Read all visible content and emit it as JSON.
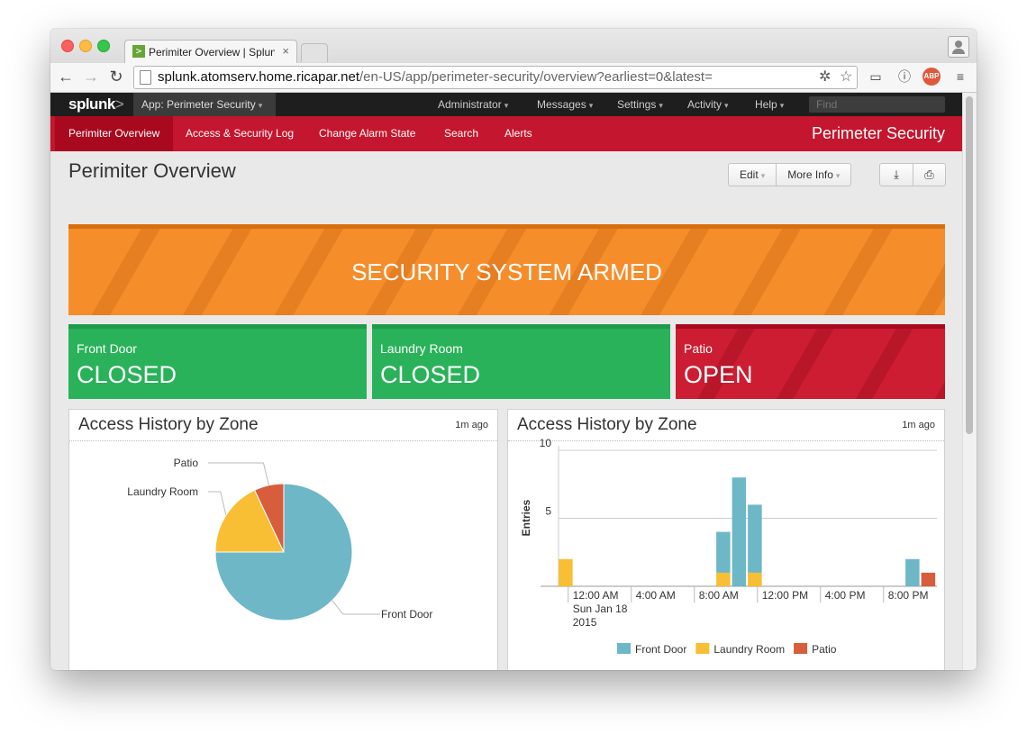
{
  "browser": {
    "tab_title": "Perimiter Overview | Splunk",
    "tab_close": "×",
    "favicon": ">",
    "url_host": "splunk.atomserv.home.ricapar.net",
    "url_path": "/en-US/app/perimeter-security/overview?earliest=0&latest=",
    "abp_label": "ABP"
  },
  "splunk_bar": {
    "logo": "splunk",
    "logo_mark": ">",
    "app_menu": "App: Perimeter Security",
    "menus": [
      "Administrator",
      "Messages",
      "Settings",
      "Activity",
      "Help"
    ],
    "find_placeholder": "Find"
  },
  "app_bar": {
    "nav": [
      "Perimiter Overview",
      "Access & Security Log",
      "Change Alarm State",
      "Search",
      "Alerts"
    ],
    "active_index": 0,
    "app_title": "Perimeter Security"
  },
  "dashboard": {
    "title": "Perimiter Overview",
    "edit_label": "Edit",
    "more_info_label": "More Info",
    "download_icon": "⤓",
    "print_icon": "⎙"
  },
  "banner": {
    "text": "SECURITY SYSTEM ARMED",
    "color": "#f68d2b"
  },
  "zones": [
    {
      "label": "Front Door",
      "state": "CLOSED",
      "status": "ok",
      "color": "#29b259"
    },
    {
      "label": "Laundry Room",
      "state": "CLOSED",
      "status": "ok",
      "color": "#29b259"
    },
    {
      "label": "Patio",
      "state": "OPEN",
      "status": "alert",
      "color": "#cc1d32"
    }
  ],
  "panels": [
    {
      "title": "Access History by Zone",
      "updated": "1m ago"
    },
    {
      "title": "Access History by Zone",
      "updated": "1m ago"
    }
  ],
  "chart_data": [
    {
      "type": "pie",
      "slices": [
        {
          "label": "Front Door",
          "value": 75,
          "color": "#6db7c6"
        },
        {
          "label": "Laundry Room",
          "value": 18,
          "color": "#f8be34"
        },
        {
          "label": "Patio",
          "value": 7,
          "color": "#d85d3c"
        }
      ]
    },
    {
      "type": "bar",
      "stacked": true,
      "ylabel": "Entries",
      "ylim": [
        0,
        10
      ],
      "yticks": [
        5,
        10
      ],
      "xticks": [
        {
          "label": [
            "12:00 AM",
            "Sun Jan 18",
            "2015"
          ],
          "slot": 1
        },
        {
          "label": [
            "4:00 AM"
          ],
          "slot": 5
        },
        {
          "label": [
            "8:00 AM"
          ],
          "slot": 9
        },
        {
          "label": [
            "12:00 PM"
          ],
          "slot": 13
        },
        {
          "label": [
            "4:00 PM"
          ],
          "slot": 17
        },
        {
          "label": [
            "8:00 PM"
          ],
          "slot": 21
        }
      ],
      "slots": 24,
      "bars": [
        {
          "slot": 0,
          "front_door": 0,
          "laundry_room": 2,
          "patio": 0
        },
        {
          "slot": 10,
          "front_door": 3,
          "laundry_room": 1,
          "patio": 0
        },
        {
          "slot": 11,
          "front_door": 8,
          "laundry_room": 0,
          "patio": 0
        },
        {
          "slot": 12,
          "front_door": 5,
          "laundry_room": 1,
          "patio": 0
        },
        {
          "slot": 22,
          "front_door": 2,
          "laundry_room": 0,
          "patio": 0
        },
        {
          "slot": 23,
          "front_door": 0,
          "laundry_room": 0,
          "patio": 1
        }
      ],
      "series": [
        {
          "name": "Front Door",
          "key": "front_door",
          "color": "#6db7c6"
        },
        {
          "name": "Laundry Room",
          "key": "laundry_room",
          "color": "#f8be34"
        },
        {
          "name": "Patio",
          "key": "patio",
          "color": "#d85d3c"
        }
      ]
    }
  ]
}
